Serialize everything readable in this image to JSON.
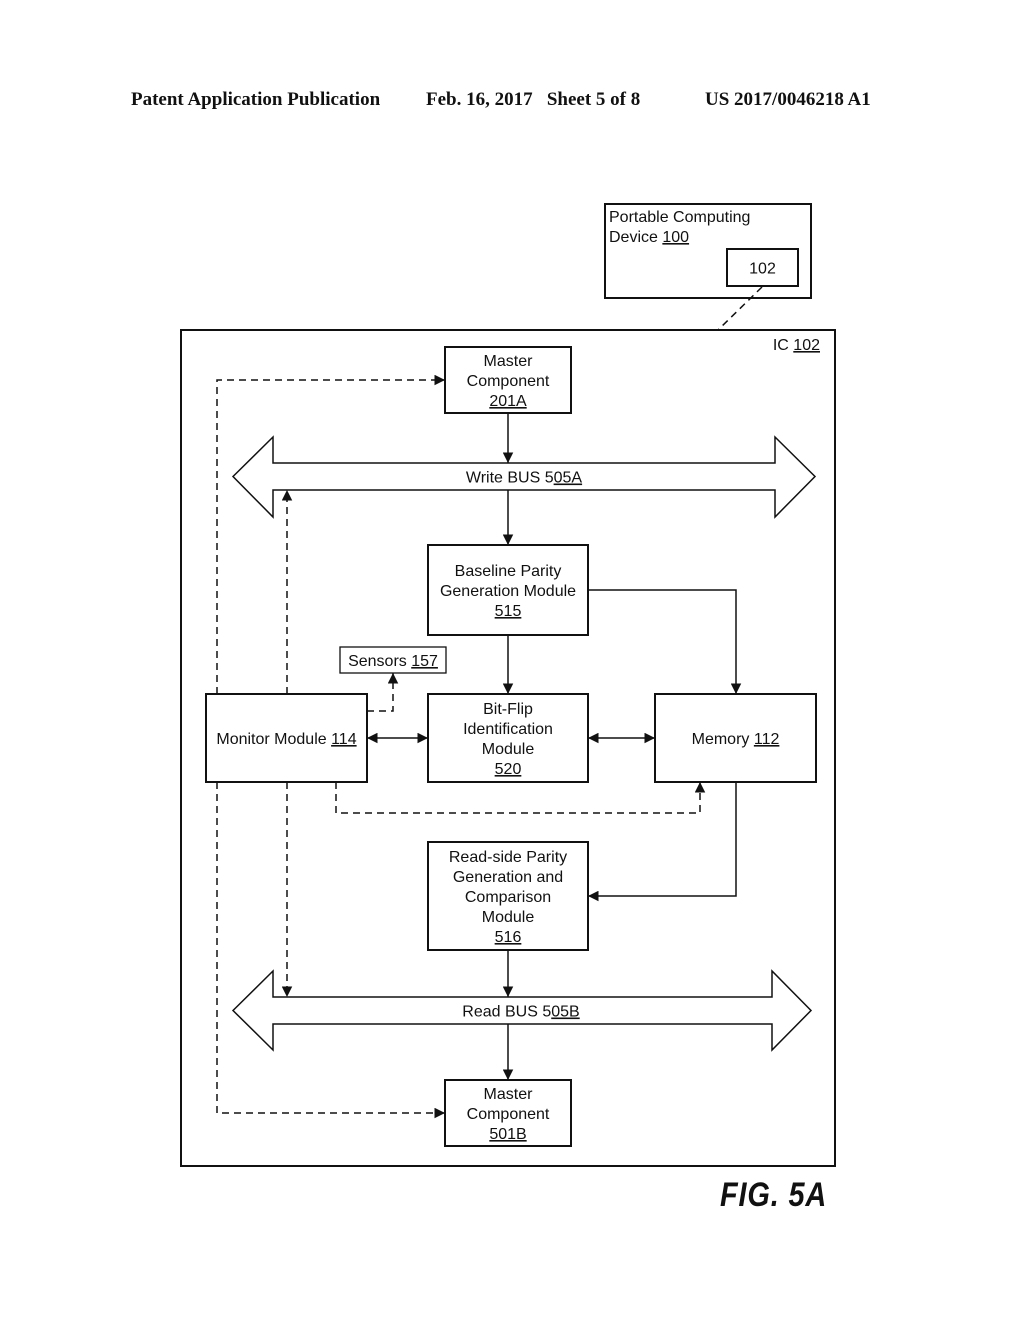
{
  "header": {
    "publication": "Patent Application Publication",
    "date_sheet": "Feb. 16, 2017   Sheet 5 of 8",
    "patent_number": "US 2017/0046218 A1"
  },
  "figure_label": "FIG.  5A",
  "nodes": {
    "portable_device": {
      "lines": [
        "Portable Computing",
        "Device "
      ],
      "ref": "100"
    },
    "device_chip": {
      "lines": [
        "102"
      ],
      "ref": ""
    },
    "ic": {
      "lines": [
        "IC "
      ],
      "ref": "102"
    },
    "master_a": {
      "lines": [
        "Master",
        "Component"
      ],
      "ref": "201A"
    },
    "write_bus": {
      "lines": [
        "Write BUS 5"
      ],
      "ref": "05A"
    },
    "baseline_parity": {
      "lines": [
        "Baseline Parity",
        "Generation Module"
      ],
      "ref": "515"
    },
    "sensors": {
      "lines": [
        "Sensors "
      ],
      "ref": "157"
    },
    "monitor": {
      "lines": [
        "Monitor Module "
      ],
      "ref": "114"
    },
    "bitflip": {
      "lines": [
        "Bit-Flip",
        "Identification",
        "Module"
      ],
      "ref": "520"
    },
    "memory": {
      "lines": [
        "Memory "
      ],
      "ref": "112"
    },
    "readside_parity": {
      "lines": [
        "Read-side Parity",
        "Generation and",
        "Comparison",
        "Module"
      ],
      "ref": "516"
    },
    "read_bus": {
      "lines": [
        "Read BUS 5"
      ],
      "ref": "05B"
    },
    "master_b": {
      "lines": [
        "Master",
        "Component"
      ],
      "ref": "501B"
    }
  },
  "edges": [
    {
      "from": "device_chip",
      "to": "ic",
      "style": "dashed",
      "arrow": "none"
    },
    {
      "from": "master_a",
      "to": "write_bus",
      "style": "solid",
      "arrow": "end"
    },
    {
      "from": "write_bus",
      "to": "baseline_parity",
      "style": "solid",
      "arrow": "end"
    },
    {
      "from": "baseline_parity",
      "to": "bitflip",
      "style": "solid",
      "arrow": "end"
    },
    {
      "from": "baseline_parity",
      "to": "memory",
      "style": "solid",
      "arrow": "end"
    },
    {
      "from": "monitor",
      "to": "bitflip",
      "style": "solid",
      "arrow": "both"
    },
    {
      "from": "bitflip",
      "to": "memory",
      "style": "solid",
      "arrow": "both"
    },
    {
      "from": "monitor",
      "to": "sensors",
      "style": "dashed",
      "arrow": "end"
    },
    {
      "from": "monitor",
      "to": "memory",
      "style": "dashed",
      "arrow": "end"
    },
    {
      "from": "monitor",
      "to": "master_a",
      "style": "dashed",
      "arrow": "end"
    },
    {
      "from": "monitor",
      "to": "write_bus",
      "style": "dashed",
      "arrow": "end"
    },
    {
      "from": "monitor",
      "to": "read_bus",
      "style": "dashed",
      "arrow": "end"
    },
    {
      "from": "monitor",
      "to": "master_b",
      "style": "dashed",
      "arrow": "end"
    },
    {
      "from": "memory",
      "to": "readside_parity",
      "style": "solid",
      "arrow": "end"
    },
    {
      "from": "readside_parity",
      "to": "read_bus",
      "style": "solid",
      "arrow": "end"
    },
    {
      "from": "read_bus",
      "to": "master_b",
      "style": "solid",
      "arrow": "end"
    }
  ]
}
